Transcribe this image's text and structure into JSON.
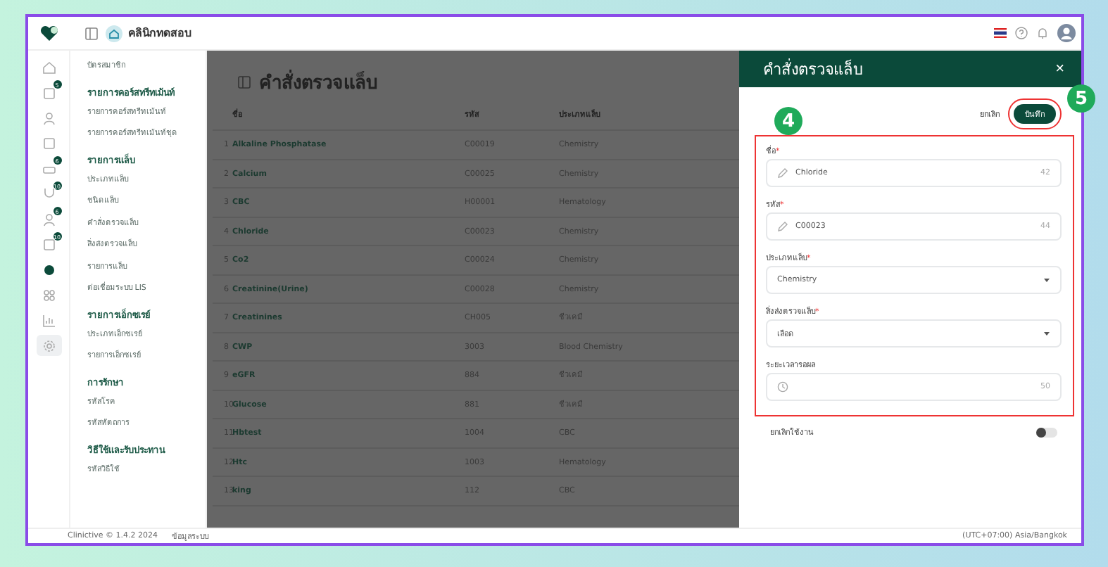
{
  "topbar": {
    "clinic": "คลินิกทดสอบ"
  },
  "rail": [
    {
      "selected": false
    },
    {
      "badge": "5",
      "selected": false
    },
    {
      "selected": false
    },
    {
      "selected": false
    },
    {
      "badge": "6",
      "selected": false
    },
    {
      "badge": "10",
      "selected": false
    },
    {
      "badge": "6",
      "selected": false
    },
    {
      "badge": "10",
      "selected": false
    },
    {
      "selected": false
    },
    {
      "selected": false
    },
    {
      "selected": false
    },
    {
      "selected": true
    }
  ],
  "sidebar": [
    {
      "kind": "item",
      "label": "บัตรสมาชิก"
    },
    {
      "kind": "section",
      "label": "รายการคอร์สทรีทเม้นท์"
    },
    {
      "kind": "item",
      "label": "รายการคอร์สทรีทเม้นท์"
    },
    {
      "kind": "item",
      "label": "รายการคอร์สทรีทเม้นท์ชุด"
    },
    {
      "kind": "section",
      "label": "รายการแล็บ"
    },
    {
      "kind": "item",
      "label": "ประเภทแล็บ"
    },
    {
      "kind": "item",
      "label": "ชนิดแล็บ"
    },
    {
      "kind": "item",
      "label": "คำสั่งตรวจแล็บ"
    },
    {
      "kind": "item",
      "label": "สิ่งส่งตรวจแล็บ"
    },
    {
      "kind": "item",
      "label": "รายการแล็บ"
    },
    {
      "kind": "item",
      "label": "ต่อเชื่อมระบบ LIS"
    },
    {
      "kind": "section",
      "label": "รายการเอ็กซเรย์"
    },
    {
      "kind": "item",
      "label": "ประเภทเอ็กซเรย์"
    },
    {
      "kind": "item",
      "label": "รายการเอ็กซเรย์"
    },
    {
      "kind": "section",
      "label": "การรักษา"
    },
    {
      "kind": "item",
      "label": "รหัสโรค"
    },
    {
      "kind": "item",
      "label": "รหัสหัตถการ"
    },
    {
      "kind": "section",
      "label": "วิธีใช้และรับประทาน"
    },
    {
      "kind": "item",
      "label": "รหัสวิธีใช้"
    }
  ],
  "page": {
    "title": "คำสั่งตรวจแล็บ"
  },
  "table": {
    "columns": [
      "",
      "ชื่อ",
      "รหัส",
      "ประเภทแล็บ"
    ],
    "rows": [
      [
        "1",
        "Alkaline Phosphatase",
        "C00019",
        "Chemistry"
      ],
      [
        "2",
        "Calcium",
        "C00025",
        "Chemistry"
      ],
      [
        "3",
        "CBC",
        "H00001",
        "Hematology"
      ],
      [
        "4",
        "Chloride",
        "C00023",
        "Chemistry"
      ],
      [
        "5",
        "Co2",
        "C00024",
        "Chemistry"
      ],
      [
        "6",
        "Creatinine(Urine)",
        "C00028",
        "Chemistry"
      ],
      [
        "7",
        "Creatinines",
        "CH005",
        "ชีวเคมี"
      ],
      [
        "8",
        "CWP",
        "3003",
        "Blood Chemistry"
      ],
      [
        "9",
        "eGFR",
        "884",
        "ชีวเคมี"
      ],
      [
        "10",
        "Glucose",
        "881",
        "ชีวเคมี"
      ],
      [
        "11",
        "Hbtest",
        "1004",
        "CBC"
      ],
      [
        "12",
        "Htc",
        "1003",
        "Hematology"
      ],
      [
        "13",
        "king",
        "112",
        "CBC"
      ]
    ]
  },
  "panel": {
    "title": "คำสั่งตรวจแล็บ",
    "close": "×",
    "cancel": "ยกเลิก",
    "save": "บันทึก",
    "fields": [
      {
        "kind": "text",
        "label": "ชื่อ",
        "required_mark": "*",
        "value": "Chloride",
        "count": "42"
      },
      {
        "kind": "text",
        "label": "รหัส",
        "required_mark": "*",
        "value": "C00023",
        "count": "44"
      },
      {
        "kind": "select",
        "label": "ประเภทแล็บ",
        "required_mark": "*",
        "value": "Chemistry"
      },
      {
        "kind": "select",
        "label": "สิ่งส่งตรวจแล็บ",
        "required_mark": "*",
        "value": "เลือด"
      },
      {
        "kind": "time",
        "label": "ระยะเวลารอผล",
        "placeholder": "50"
      }
    ],
    "toggle": {
      "label": "ยกเลิกใช้งาน",
      "on": false
    }
  },
  "callouts": [
    "4",
    "5"
  ],
  "footer": {
    "version": "Clinictive © 1.4.2 2024",
    "info": "ข้อมูลระบบ",
    "timezone": "(UTC+07:00) Asia/Bangkok"
  }
}
